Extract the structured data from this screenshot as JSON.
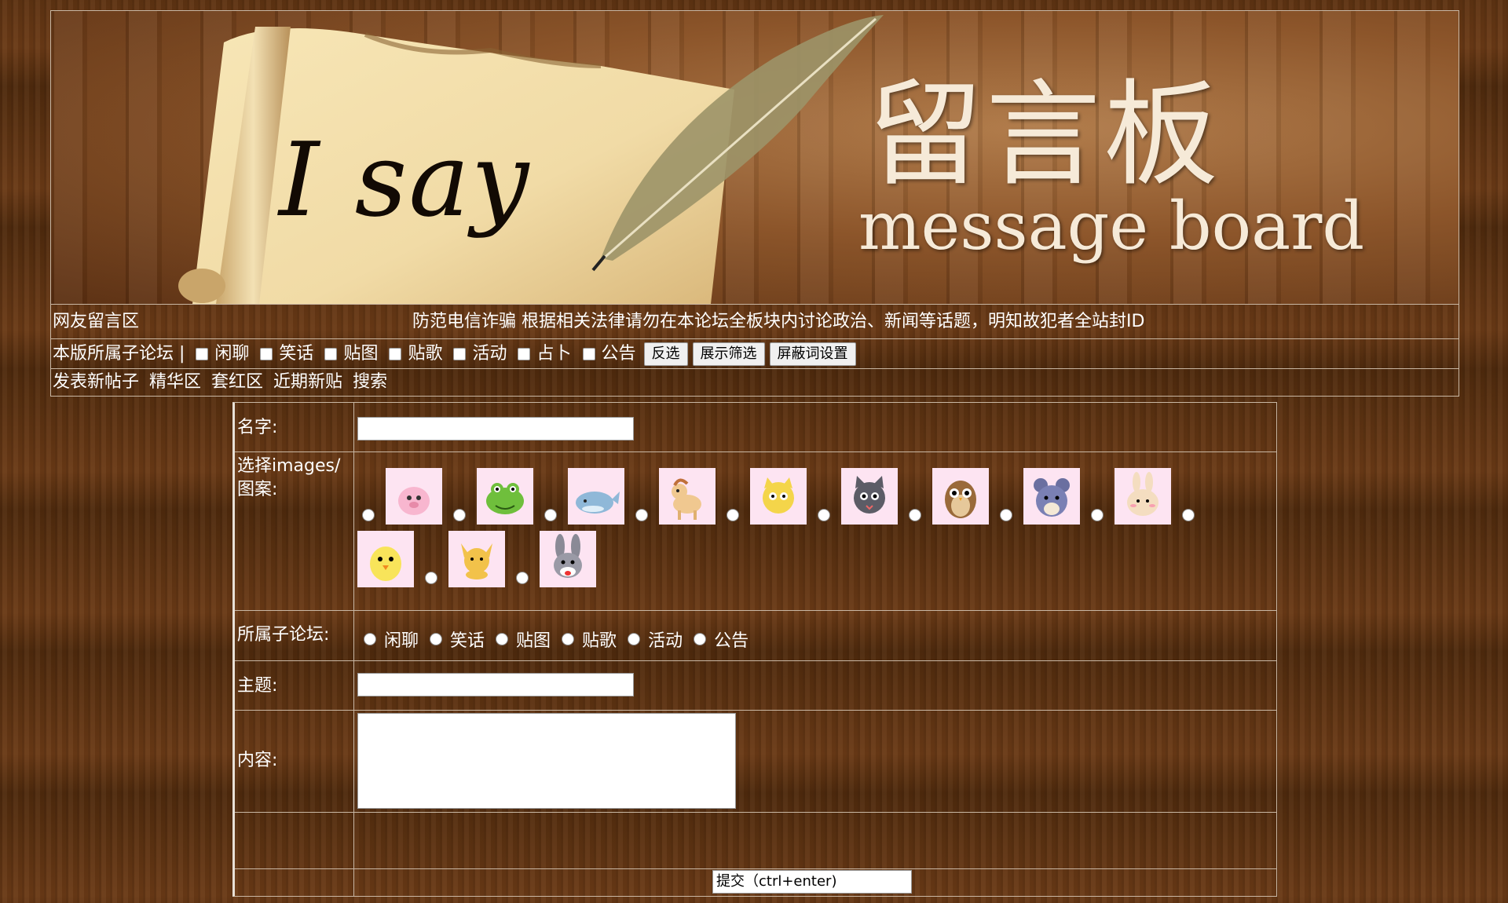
{
  "banner": {
    "script_text": "I say",
    "title_cn": "留言板",
    "title_en": "message board"
  },
  "header": {
    "section_title": "网友留言区",
    "notice": "防范电信诈骗 根据相关法律请勿在本论坛全板块内讨论政治、新闻等话题，明知故犯者全站封ID"
  },
  "filter_bar": {
    "label": "本版所属子论坛 |",
    "options": [
      "闲聊",
      "笑话",
      "贴图",
      "贴歌",
      "活动",
      "占卜",
      "公告"
    ],
    "buttons": {
      "invert": "反选",
      "show_filter": "展示筛选",
      "block_words": "屏蔽词设置"
    }
  },
  "nav": {
    "links": [
      "发表新帖子",
      "精华区",
      "套红区",
      "近期新贴",
      "搜索"
    ]
  },
  "form": {
    "name_label": "名字:",
    "images_label": "选择images/图案:",
    "avatars": [
      "pig-avatar",
      "frog-avatar",
      "whale-avatar",
      "pony-avatar",
      "cat-yellow-avatar",
      "cat-grey-avatar",
      "owl-avatar",
      "mouse-avatar",
      "rabbit-avatar",
      "chick-avatar",
      "fox-avatar",
      "bunny-grey-avatar"
    ],
    "forum_label": "所属子论坛:",
    "forum_options": [
      "闲聊",
      "笑话",
      "贴图",
      "贴歌",
      "活动",
      "公告"
    ],
    "subject_label": "主题:",
    "content_label": "内容:",
    "submit_label": "提交（ctrl+enter)"
  },
  "colors": {
    "background": "#5a3010",
    "border": "#c9b7a4",
    "avatar_bg": "#fde4f2"
  }
}
